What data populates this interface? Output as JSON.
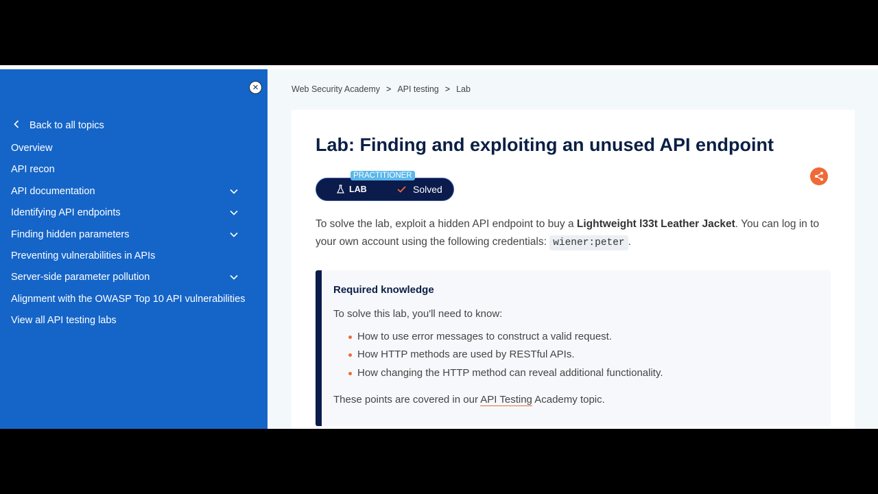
{
  "sidebar": {
    "close_icon": "close-icon",
    "back_label": "Back to all topics",
    "items": [
      {
        "label": "Overview",
        "expandable": false
      },
      {
        "label": "API recon",
        "expandable": false
      },
      {
        "label": "API documentation",
        "expandable": true
      },
      {
        "label": "Identifying API endpoints",
        "expandable": true
      },
      {
        "label": "Finding hidden parameters",
        "expandable": true
      },
      {
        "label": "Preventing vulnerabilities in APIs",
        "expandable": false
      },
      {
        "label": "Server-side parameter pollution",
        "expandable": true
      },
      {
        "label": "Alignment with the OWASP Top 10 API vulnerabilities",
        "expandable": false
      },
      {
        "label": "View all API testing labs",
        "expandable": false
      }
    ]
  },
  "breadcrumb": {
    "items": [
      "Web Security Academy",
      "API testing",
      "Lab"
    ],
    "separator": ">"
  },
  "lab": {
    "title": "Lab: Finding and exploiting an unused API endpoint",
    "level": "PRACTITIONER",
    "type_label": "LAB",
    "status": "Solved",
    "intro_1": "To solve the lab, exploit a hidden API endpoint to buy a ",
    "intro_bold": "Lightweight l33t Leather Jacket",
    "intro_2": ". You can log in to your own account using the following credentials: ",
    "credentials": "wiener:peter",
    "intro_3": "."
  },
  "knowledge": {
    "title": "Required knowledge",
    "lead": "To solve this lab, you'll need to know:",
    "points": [
      "How to use error messages to construct a valid request.",
      "How HTTP methods are used by RESTful APIs.",
      "How changing the HTTP method can reveal additional functionality."
    ],
    "foot_1": "These points are covered in our ",
    "foot_link": "API Testing",
    "foot_2": " Academy topic."
  },
  "colors": {
    "sidebar_bg": "#1565c8",
    "accent_orange": "#ef6a36",
    "navy": "#0a1b4c",
    "level_badge": "#5ab7ea"
  }
}
